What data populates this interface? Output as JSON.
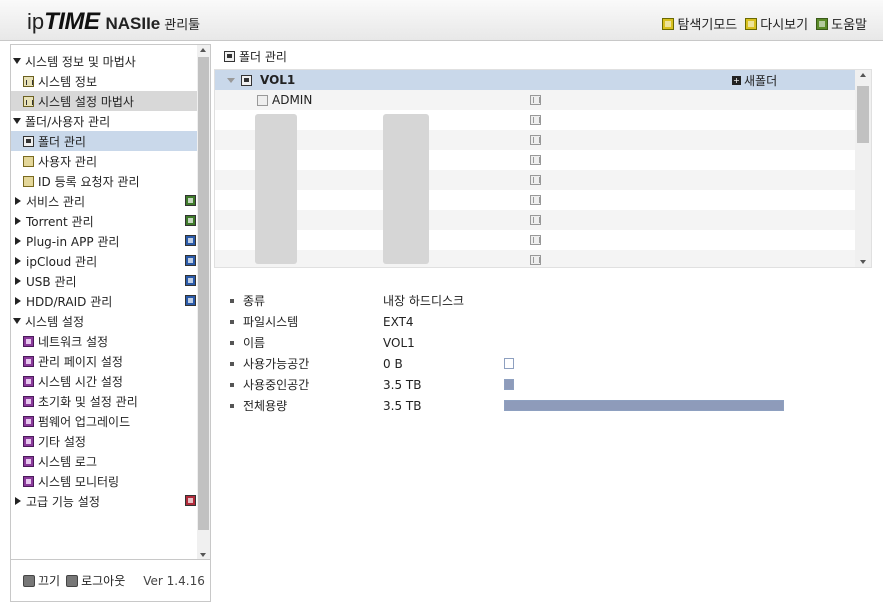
{
  "header": {
    "brand_ip": "ip",
    "brand_time": "TIME",
    "brand_model": "NASIIe",
    "brand_admin": "관리툴",
    "links": [
      {
        "label": "탐색기모드",
        "icon": "explorer-icon"
      },
      {
        "label": "다시보기",
        "icon": "refresh-icon"
      },
      {
        "label": "도움말",
        "icon": "help-icon"
      }
    ]
  },
  "sidebar": {
    "groups": {
      "system_info_wizard": "시스템 정보 및 마법사",
      "system_info": "시스템 정보",
      "system_setup_wizard": "시스템 설정 마법사",
      "folder_user_mgmt": "폴더/사용자 관리",
      "folder_mgmt": "폴더 관리",
      "user_mgmt": "사용자 관리",
      "id_request_mgmt": "ID 등록 요청자 관리",
      "service_mgmt": "서비스 관리",
      "torrent_mgmt": "Torrent 관리",
      "plugin_mgmt": "Plug-in APP 관리",
      "ipcloud_mgmt": "ipCloud 관리",
      "usb_mgmt": "USB 관리",
      "hdd_raid_mgmt": "HDD/RAID 관리",
      "system_settings": "시스템 설정",
      "network_settings": "네트워크 설정",
      "admin_page_settings": "관리 페이지 설정",
      "system_time_settings": "시스템 시간 설정",
      "reset_settings_mgmt": "초기화 및 설정 관리",
      "firmware_upgrade": "펌웨어 업그레이드",
      "other_settings": "기타 설정",
      "system_log": "시스템 로그",
      "system_monitoring": "시스템 모니터링",
      "advanced_settings": "고급 기능 설정"
    },
    "footer": {
      "power_off": "끄기",
      "logout": "로그아웃",
      "version": "Ver 1.4.16"
    }
  },
  "main": {
    "title": "폴더 관리",
    "tree": {
      "volume": "VOL1",
      "new_folder": "새폴더",
      "first_folder": "ADMIN"
    },
    "details": [
      {
        "label": "종류",
        "value": "내장 하드디스크"
      },
      {
        "label": "파일시스템",
        "value": "EXT4"
      },
      {
        "label": "이름",
        "value": "VOL1"
      },
      {
        "label": "사용가능공간",
        "value": "0 B"
      },
      {
        "label": "사용중인공간",
        "value": "3.5 TB"
      },
      {
        "label": "전체용량",
        "value": "3.5 TB"
      }
    ],
    "usage_fraction": 1.0
  },
  "colors": {
    "selected_row": "#c9d8ea",
    "usage_bar": "#8e9bba"
  }
}
